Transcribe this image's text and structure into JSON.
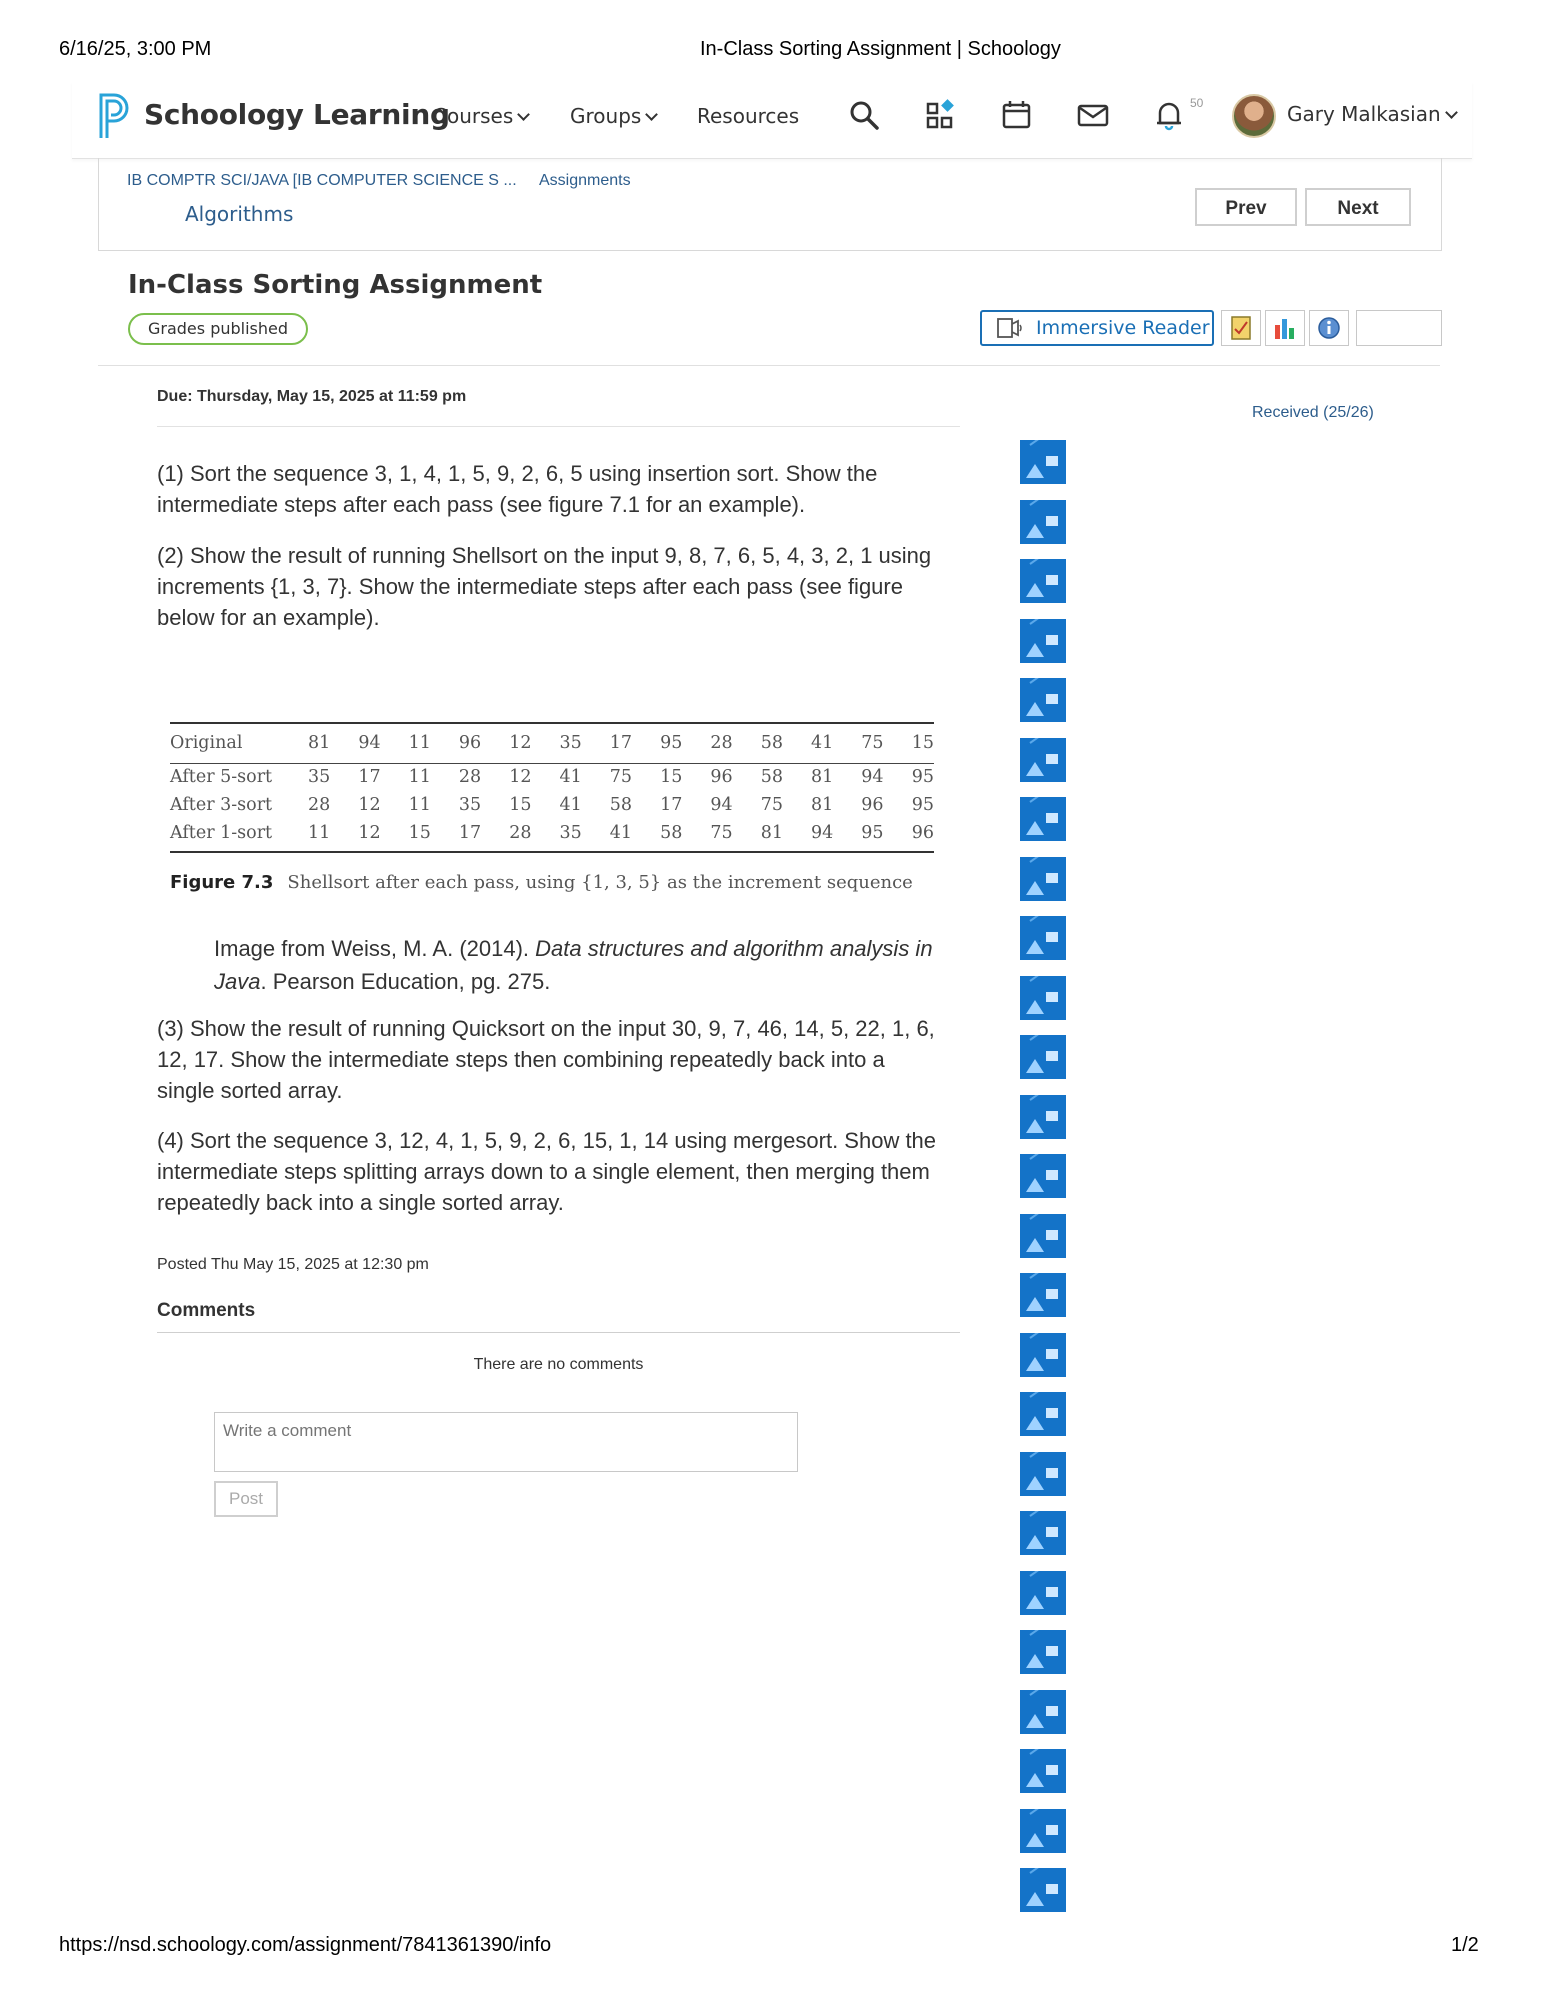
{
  "print_header": {
    "datetime": "6/16/25, 3:00 PM",
    "title": "In-Class Sorting Assignment | Schoology"
  },
  "nav": {
    "brand": "Schoology Learning",
    "items": [
      "Courses",
      "Groups",
      "Resources"
    ],
    "notification_count": "50",
    "user_name": "Gary Malkasian",
    "icons": [
      "search-icon",
      "apps-icon",
      "calendar-icon",
      "mail-icon",
      "bell-icon"
    ],
    "brand_color": "#29a3d8"
  },
  "breadcrumb": {
    "course": "IB COMPTR SCI/JAVA [IB COMPUTER SCIENCE S ...",
    "section": "Assignments",
    "folder": "Algorithms",
    "prev_label": "Prev",
    "next_label": "Next"
  },
  "assignment": {
    "title": "In-Class Sorting Assignment",
    "status_badge": "Grades published",
    "immersive_reader_label": "Immersive Reader",
    "due": "Due: Thursday, May 15, 2025 at 11:59 pm",
    "received": "Received (25/26)",
    "q1": "(1)  Sort the sequence 3, 1, 4, 1, 5, 9, 2, 6, 5 using insertion sort. Show the intermediate steps after each pass (see figure 7.1 for an example).",
    "q2": "(2)  Show the result of running Shellsort on the input 9, 8, 7, 6, 5, 4, 3, 2, 1 using increments {1, 3, 7}. Show the intermediate steps after each pass (see figure below for an example).",
    "figure": {
      "rows": [
        {
          "label": "Original",
          "values": [
            "81",
            "94",
            "11",
            "96",
            "12",
            "35",
            "17",
            "95",
            "28",
            "58",
            "41",
            "75",
            "15"
          ]
        },
        {
          "label": "After 5-sort",
          "values": [
            "35",
            "17",
            "11",
            "28",
            "12",
            "41",
            "75",
            "15",
            "96",
            "58",
            "81",
            "94",
            "95"
          ]
        },
        {
          "label": "After 3-sort",
          "values": [
            "28",
            "12",
            "11",
            "35",
            "15",
            "41",
            "58",
            "17",
            "94",
            "75",
            "81",
            "96",
            "95"
          ]
        },
        {
          "label": "After 1-sort",
          "values": [
            "11",
            "12",
            "15",
            "17",
            "28",
            "35",
            "41",
            "58",
            "75",
            "81",
            "94",
            "95",
            "96"
          ]
        }
      ],
      "caption_label": "Figure 7.3",
      "caption_text": "Shellsort after each pass, using {1, 3, 5} as the increment sequence"
    },
    "source_prefix": "Image from Weiss, M. A. (2014). ",
    "source_italic": "Data structures and algorithm analysis in Java",
    "source_suffix": ". Pearson Education, pg. 275.",
    "q3": "(3)  Show the result of running Quicksort on the input 30, 9, 7, 46, 14, 5, 22, 1, 6, 12, 17. Show the intermediate steps then combining repeatedly back into a single sorted array.",
    "q4": "(4)  Sort the sequence 3, 12, 4, 1, 5, 9, 2, 6, 15, 1, 14 using mergesort. Show the intermediate steps splitting arrays down to a single element, then merging them repeatedly back into a single sorted array.",
    "posted": "Posted Thu May 15, 2025 at 12:30 pm"
  },
  "comments": {
    "heading": "Comments",
    "empty_text": "There are no comments",
    "placeholder": "Write a comment",
    "post_label": "Post"
  },
  "submission_thumbnails": {
    "count": 25,
    "icon": "image-placeholder-icon"
  },
  "print_footer": {
    "url": "https://nsd.schoology.com/assignment/7841361390/info",
    "page": "1/2"
  }
}
